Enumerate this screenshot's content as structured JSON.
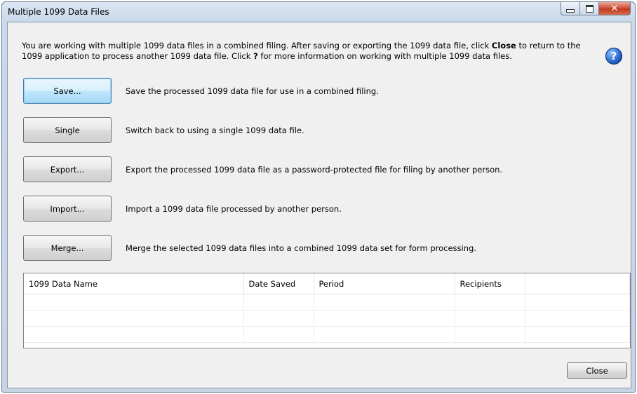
{
  "window": {
    "title": "Multiple 1099 Data Files"
  },
  "intro": {
    "part1": "You are working with multiple 1099 data files in a combined filing. After saving or exporting the 1099 data file, click ",
    "close_word": "Close",
    "part2": " to return to the 1099 application to process another 1099 data file. Click ",
    "q_word": "?",
    "part3": " for more information on working with multiple 1099 data files."
  },
  "help": {
    "glyph": "?"
  },
  "actions": [
    {
      "label": "Save...",
      "description": "Save the processed 1099 data file for use in a combined filing."
    },
    {
      "label": "Single",
      "description": "Switch back to using a single 1099 data file."
    },
    {
      "label": "Export...",
      "description": "Export the processed 1099 data file as a password-protected file for filing by another person."
    },
    {
      "label": "Import...",
      "description": "Import a 1099 data file processed by another person."
    },
    {
      "label": "Merge...",
      "description": "Merge the selected 1099 data files into a combined 1099 data set for form processing."
    }
  ],
  "table": {
    "columns": [
      "1099 Data Name",
      "Date Saved",
      "Period",
      "Recipients",
      ""
    ]
  },
  "footer": {
    "close_label": "Close"
  }
}
